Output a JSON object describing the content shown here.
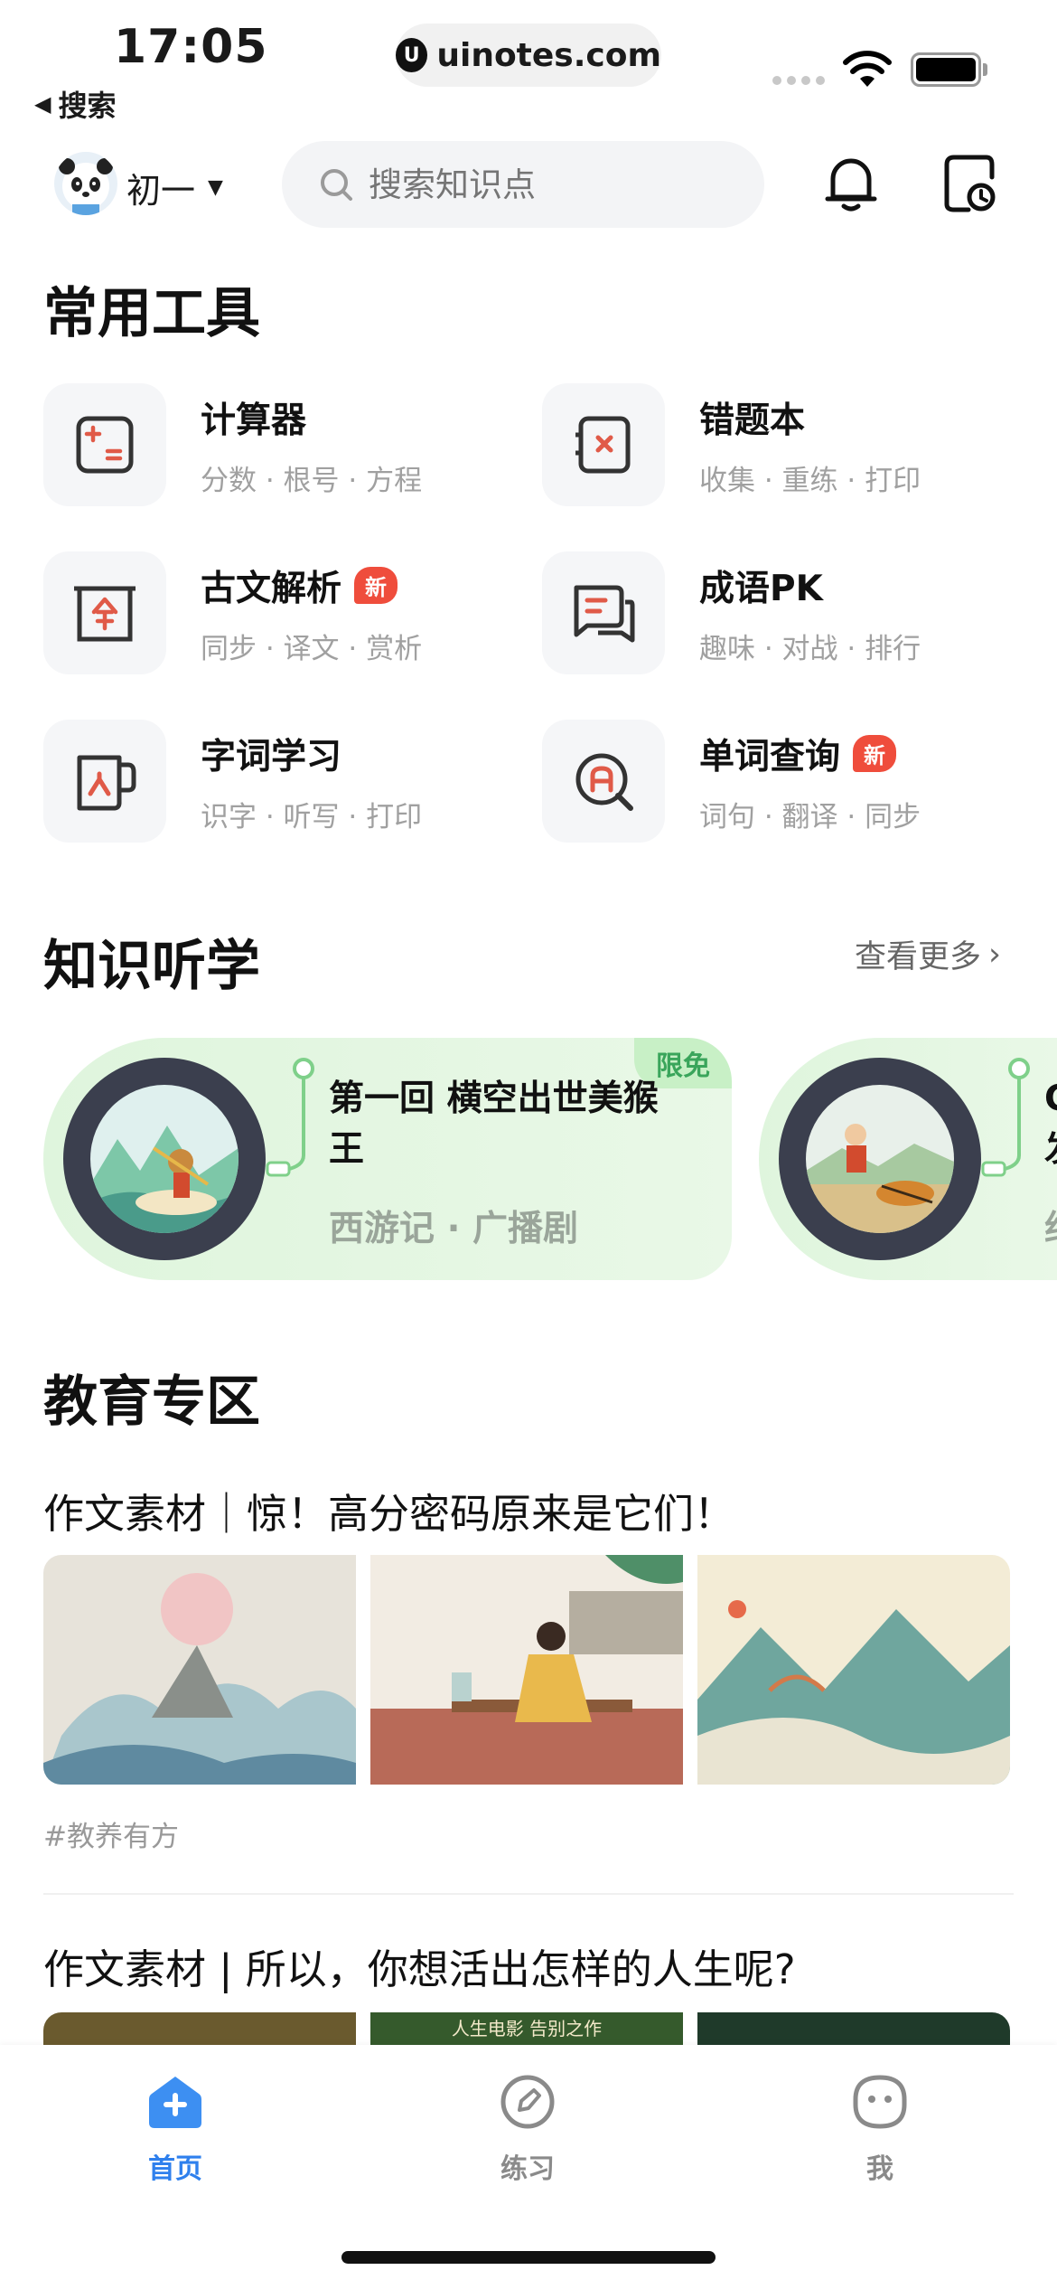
{
  "status_bar": {
    "time": "17:05",
    "back_label": "搜索",
    "url": "uinotes.com",
    "url_logo": "U"
  },
  "header": {
    "grade": "初一",
    "search_placeholder": "搜索知识点",
    "bell_icon": "bell-icon",
    "history_icon": "history-icon"
  },
  "tools_section": {
    "title": "常用工具",
    "new_badge": "新",
    "items": [
      {
        "name": "计算器",
        "desc": "分数 · 根号 · 方程",
        "icon": "calculator-icon"
      },
      {
        "name": "错题本",
        "desc": "收集 · 重练 · 打印",
        "icon": "mistake-book-icon"
      },
      {
        "name": "古文解析",
        "desc": "同步 · 译文 · 赏析",
        "icon": "classical-text-icon",
        "badge": true
      },
      {
        "name": "成语PK",
        "desc": "趣味 · 对战 · 排行",
        "icon": "idiom-chat-icon"
      },
      {
        "name": "字词学习",
        "desc": "识字 · 听写 · 打印",
        "icon": "character-card-icon"
      },
      {
        "name": "单词查询",
        "desc": "词句 · 翻译 · 同步",
        "icon": "word-search-icon",
        "badge": true
      }
    ]
  },
  "audio_section": {
    "title": "知识听学",
    "more_label": "查看更多",
    "cards": [
      {
        "tag": "限免",
        "title": "第一回 横空出世美猴王",
        "subtitle": "西游记 · 广播剧"
      },
      {
        "title": "C 发",
        "subtitle": "约"
      }
    ]
  },
  "edu_section": {
    "title": "教育专区",
    "articles": [
      {
        "title": "作文素材｜惊！高分密码原来是它们！",
        "hashtag": "#教养有方"
      },
      {
        "title": "作文素材 | 所以，你想活出怎样的人生呢?",
        "banner_text": "人生电影 告别之作"
      }
    ]
  },
  "tabbar": {
    "tabs": [
      {
        "label": "首页",
        "icon": "home-plus-icon",
        "active": true
      },
      {
        "label": "练习",
        "icon": "practice-compass-icon"
      },
      {
        "label": "我",
        "icon": "profile-face-icon"
      }
    ],
    "active_color": "#2f80ed",
    "inactive_color": "#8a8a8a"
  },
  "colors": {
    "accent_red": "#e05a48",
    "new_badge": "#ef4d3c",
    "audio_bg": "#dff5dd",
    "free_tag_text": "#3aa55b"
  }
}
